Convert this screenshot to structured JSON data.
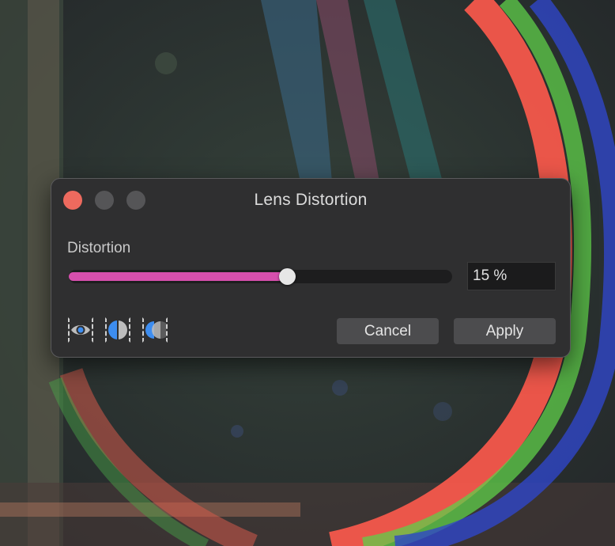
{
  "dialog": {
    "title": "Lens Distortion",
    "parameter": {
      "label": "Distortion",
      "value_text": "15 %",
      "slider_fraction": 0.57
    },
    "buttons": {
      "cancel_label": "Cancel",
      "apply_label": "Apply"
    },
    "view_icons": [
      "eye-icon",
      "split-view-icon",
      "compare-view-icon"
    ]
  },
  "colors": {
    "accent": "#d64fad",
    "close": "#ed6a5e",
    "icon_blue": "#3d8df0"
  }
}
